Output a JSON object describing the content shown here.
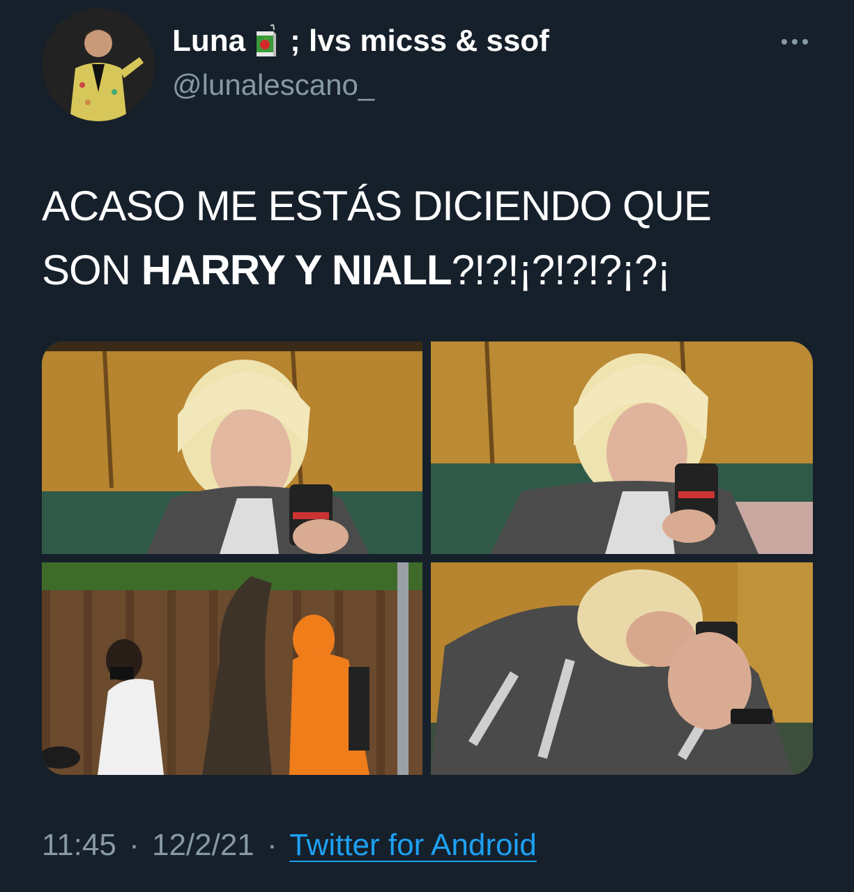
{
  "tweet": {
    "display_name": "Luna",
    "display_name_suffix": "; lvs micss & ssof",
    "name_emoji": "beverage-box-icon",
    "handle": "@lunalescano_",
    "text_line1": "ACASO ME ESTÁS DICIENDO QUE",
    "text_line2_prefix": "SON ",
    "text_line2_bold": "HARRY Y NIALL",
    "text_line2_suffix": "?!?!¡?!?!?¡?¡",
    "time": "11:45",
    "date": "12/2/21",
    "separator": "·",
    "source": "Twitter for Android"
  },
  "media": [
    {
      "name": "photo-blond-man-looking-down-at-phone"
    },
    {
      "name": "photo-blond-man-staring-at-phone"
    },
    {
      "name": "photo-two-people-outdoors-by-tree"
    },
    {
      "name": "photo-blond-man-rushing-with-phone"
    }
  ],
  "colors": {
    "background": "#15202b",
    "text": "#ffffff",
    "secondary_text": "#8899a6",
    "link": "#1da1f2"
  }
}
